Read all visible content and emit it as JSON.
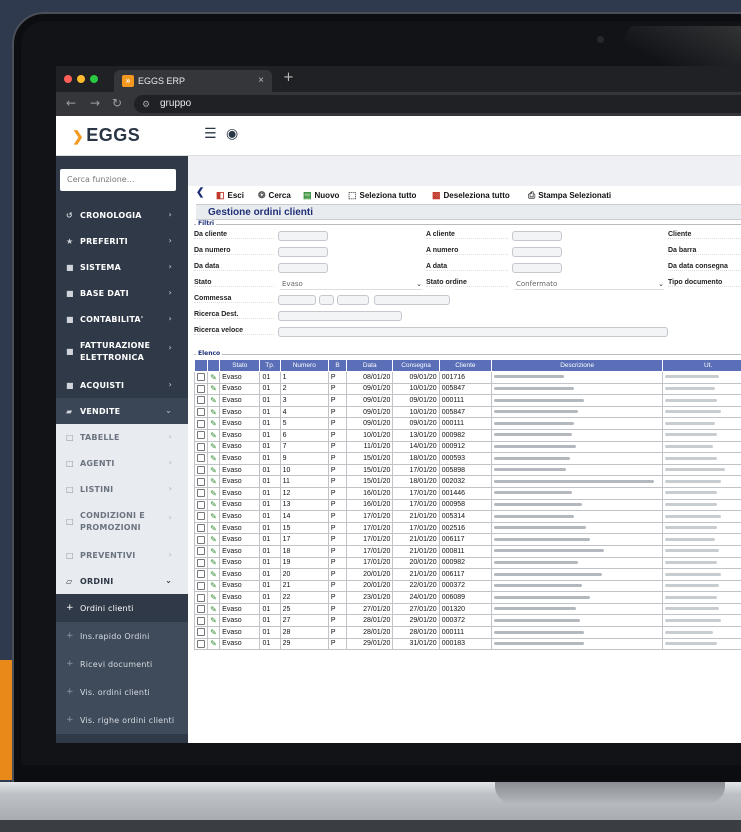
{
  "browser": {
    "tab_title": "EGGS ERP",
    "tab_close": "×",
    "new_tab": "+",
    "url": "gruppo"
  },
  "app": {
    "logo": "EGGS",
    "search_placeholder": "Cerca funzione..."
  },
  "sidebar": {
    "items": [
      {
        "label": "CRONOLOGIA"
      },
      {
        "label": "PREFERITI"
      },
      {
        "label": "SISTEMA"
      },
      {
        "label": "BASE DATI"
      },
      {
        "label": "CONTABILITA'"
      },
      {
        "label": "FATTURAZIONE ELETTRONICA"
      },
      {
        "label": "ACQUISTI"
      },
      {
        "label": "VENDITE"
      },
      {
        "label": "TABELLE"
      },
      {
        "label": "AGENTI"
      },
      {
        "label": "LISTINI"
      },
      {
        "label": "CONDIZIONI E PROMOZIONI"
      },
      {
        "label": "PREVENTIVI"
      },
      {
        "label": "ORDINI"
      },
      {
        "label": "Ordini clienti"
      },
      {
        "label": "Ins.rapido Ordini"
      },
      {
        "label": "Ricevi documenti"
      },
      {
        "label": "Vis. ordini clienti"
      },
      {
        "label": "Vis. righe ordini clienti"
      }
    ]
  },
  "toolbar": {
    "esci": "Esci",
    "cerca": "Cerca",
    "nuovo": "Nuovo",
    "seleziona": "Seleziona tutto",
    "deseleziona": "Deseleziona tutto",
    "stampa": "Stampa Selezionati"
  },
  "page_title": "Gestione ordini clienti",
  "filters": {
    "legend": "Filtri",
    "da_cliente": "Da cliente",
    "a_cliente": "A cliente",
    "cliente": "Cliente",
    "da_numero": "Da numero",
    "a_numero": "A numero",
    "da_barra": "Da barra",
    "da_data": "Da data",
    "a_data": "A data",
    "da_data_consegna": "Da data consegna",
    "stato": "Stato",
    "stato_value": "Evaso",
    "stato_ordine": "Stato ordine",
    "stato_ordine_value": "Confermato",
    "tipo_documento": "Tipo documento",
    "commessa": "Commessa",
    "ricerca_dest": "Ricerca Dest.",
    "ricerca_veloce": "Ricerca veloce"
  },
  "list": {
    "legend": "Elenco",
    "columns": [
      "Stato",
      "Tp.",
      "Numero",
      "B",
      "Data",
      "Consegna",
      "Cliente",
      "Descrizione",
      "Ut."
    ],
    "rows": [
      [
        "Evaso",
        "01",
        "1",
        "P",
        "08/01/20",
        "09/01/20",
        "001716"
      ],
      [
        "Evaso",
        "01",
        "2",
        "P",
        "09/01/20",
        "10/01/20",
        "005847"
      ],
      [
        "Evaso",
        "01",
        "3",
        "P",
        "09/01/20",
        "09/01/20",
        "000111"
      ],
      [
        "Evaso",
        "01",
        "4",
        "P",
        "09/01/20",
        "10/01/20",
        "005847"
      ],
      [
        "Evaso",
        "01",
        "5",
        "P",
        "09/01/20",
        "09/01/20",
        "000111"
      ],
      [
        "Evaso",
        "01",
        "6",
        "P",
        "10/01/20",
        "13/01/20",
        "000982"
      ],
      [
        "Evaso",
        "01",
        "7",
        "P",
        "11/01/20",
        "14/01/20",
        "000912"
      ],
      [
        "Evaso",
        "01",
        "9",
        "P",
        "15/01/20",
        "18/01/20",
        "000593"
      ],
      [
        "Evaso",
        "01",
        "10",
        "P",
        "15/01/20",
        "17/01/20",
        "005898"
      ],
      [
        "Evaso",
        "01",
        "11",
        "P",
        "15/01/20",
        "18/01/20",
        "002032"
      ],
      [
        "Evaso",
        "01",
        "12",
        "P",
        "16/01/20",
        "17/01/20",
        "001446"
      ],
      [
        "Evaso",
        "01",
        "13",
        "P",
        "16/01/20",
        "17/01/20",
        "000958"
      ],
      [
        "Evaso",
        "01",
        "14",
        "P",
        "17/01/20",
        "21/01/20",
        "005314"
      ],
      [
        "Evaso",
        "01",
        "15",
        "P",
        "17/01/20",
        "17/01/20",
        "002516"
      ],
      [
        "Evaso",
        "01",
        "17",
        "P",
        "17/01/20",
        "21/01/20",
        "006117"
      ],
      [
        "Evaso",
        "01",
        "18",
        "P",
        "17/01/20",
        "21/01/20",
        "000811"
      ],
      [
        "Evaso",
        "01",
        "19",
        "P",
        "17/01/20",
        "20/01/20",
        "000982"
      ],
      [
        "Evaso",
        "01",
        "20",
        "P",
        "20/01/20",
        "21/01/20",
        "006117"
      ],
      [
        "Evaso",
        "01",
        "21",
        "P",
        "20/01/20",
        "22/01/20",
        "000372"
      ],
      [
        "Evaso",
        "01",
        "22",
        "P",
        "23/01/20",
        "24/01/20",
        "006089"
      ],
      [
        "Evaso",
        "01",
        "25",
        "P",
        "27/01/20",
        "27/01/20",
        "001320"
      ],
      [
        "Evaso",
        "01",
        "27",
        "P",
        "28/01/20",
        "29/01/20",
        "000372"
      ],
      [
        "Evaso",
        "01",
        "28",
        "P",
        "28/01/20",
        "28/01/20",
        "000111"
      ],
      [
        "Evaso",
        "01",
        "29",
        "P",
        "29/01/20",
        "31/01/20",
        "000183"
      ]
    ]
  }
}
